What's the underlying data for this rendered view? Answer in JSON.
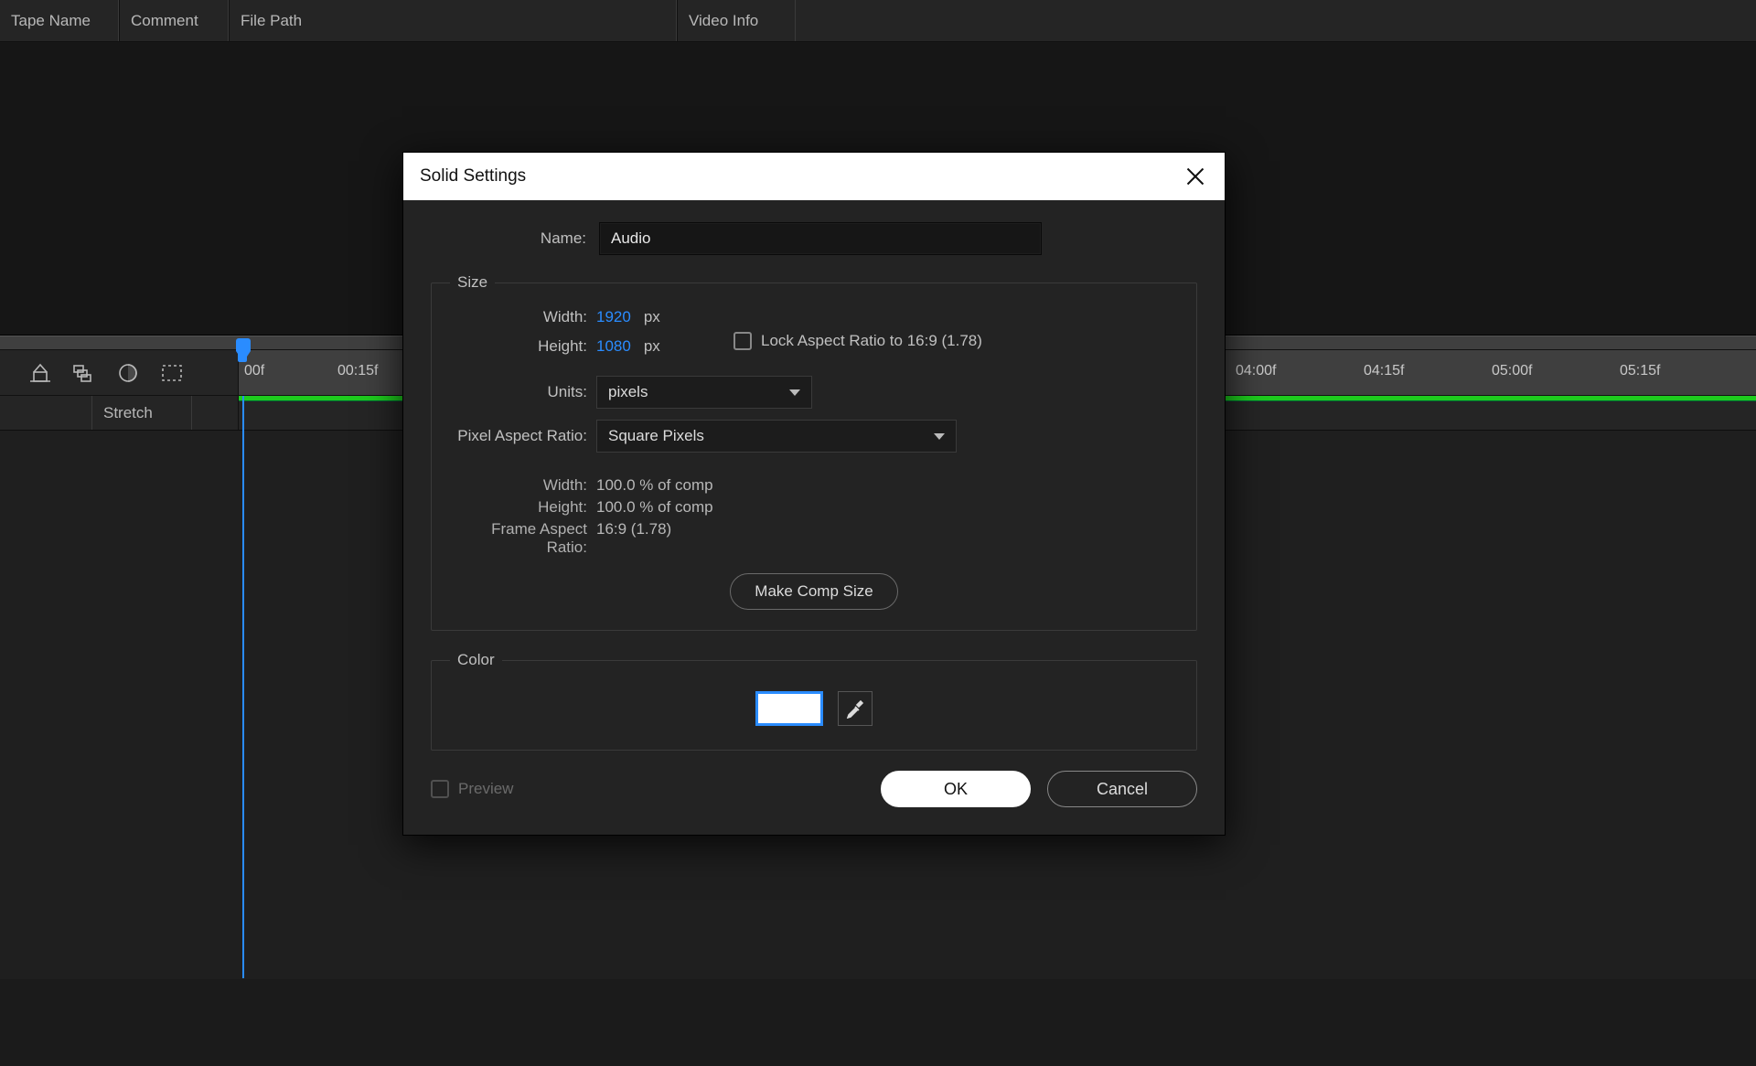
{
  "columns": {
    "tape_name": "Tape Name",
    "comment": "Comment",
    "file_path": "File Path",
    "video_info": "Video Info"
  },
  "timeline": {
    "stretch_label": "Stretch",
    "time_labels": [
      "00f",
      "00:15f",
      "04:00f",
      "04:15f",
      "05:00f",
      "05:15f"
    ]
  },
  "dialog": {
    "title": "Solid Settings",
    "name_label": "Name:",
    "name_value": "Audio",
    "size": {
      "legend": "Size",
      "width_label": "Width:",
      "width_value": "1920",
      "height_label": "Height:",
      "height_value": "1080",
      "px_unit": "px",
      "lock_label": "Lock Aspect Ratio to 16:9 (1.78)",
      "units_label": "Units:",
      "units_value": "pixels",
      "par_label": "Pixel Aspect Ratio:",
      "par_value": "Square Pixels",
      "info_width_label": "Width:",
      "info_width_value": "100.0 % of comp",
      "info_height_label": "Height:",
      "info_height_value": "100.0 % of comp",
      "info_far_label": "Frame Aspect Ratio:",
      "info_far_value": "16:9 (1.78)",
      "make_comp_label": "Make Comp Size"
    },
    "color_legend": "Color",
    "color_value": "#ffffff",
    "preview_label": "Preview",
    "ok_label": "OK",
    "cancel_label": "Cancel"
  }
}
